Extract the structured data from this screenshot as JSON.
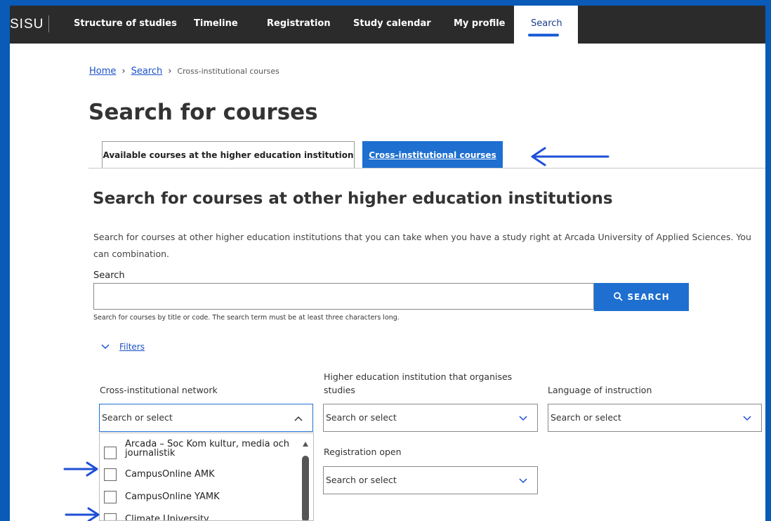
{
  "nav": {
    "logo": "SISU",
    "items": [
      "Structure of studies",
      "Timeline",
      "Registration",
      "Study calendar",
      "My profile"
    ],
    "active": "Search"
  },
  "breadcrumb": {
    "home": "Home",
    "search": "Search",
    "current": "Cross-institutional courses"
  },
  "page_title": "Search for courses",
  "tabs": {
    "tab1": "Available courses at the higher education institution",
    "tab2": "Cross-institutional courses"
  },
  "section_title": "Search for courses at other higher education institutions",
  "description": "Search for courses at other higher education institutions that you can take when you have a study right at Arcada University of Applied Sciences. You can combination.",
  "search": {
    "label": "Search",
    "value": "",
    "button": "SEARCH",
    "hint": "Search for courses by title or code. The search term must be at least three characters long."
  },
  "filters_label": "Filters",
  "filter_fields": {
    "network_label": "Cross-institutional network",
    "institution_label": "Higher education institution that organises studies",
    "language_label": "Language of instruction",
    "registration_label": "Registration open",
    "placeholder": "Search or select"
  },
  "network_options": [
    "Arcada – Soc Kom kultur, media och journalistik",
    "CampusOnline AMK",
    "CampusOnline YAMK",
    "Climate University"
  ],
  "colors": {
    "accent": "#1e6fd0",
    "annotation": "#1e4fd6",
    "nav_bg": "#2b2b2b",
    "frame_bg": "#0a5ab8"
  }
}
